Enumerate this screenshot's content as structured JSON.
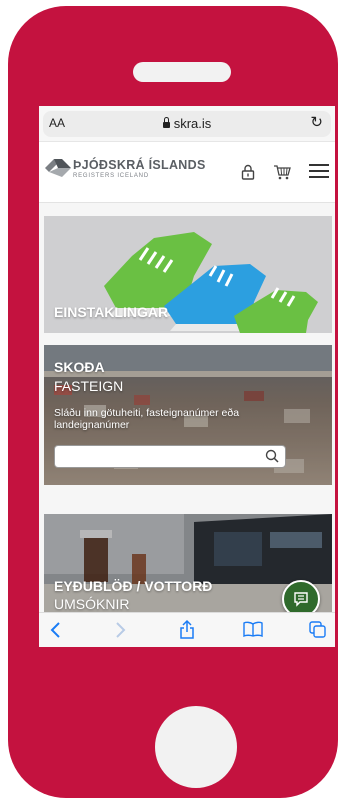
{
  "browser": {
    "text_size_label": "AA",
    "host": "skra.is"
  },
  "site": {
    "logo_main": "ÞJÓÐSKRÁ ÍSLANDS",
    "logo_sub": "REGISTERS ICELAND"
  },
  "cards": {
    "individuals": {
      "title": "EINSTAKLINGAR"
    },
    "property": {
      "title": "SKOÐA",
      "subtitle": "FASTEIGN",
      "description": "Sláðu inn götuheiti, fasteignanúmer eða landeignanúmer",
      "search_value": ""
    },
    "forms": {
      "title": "EYÐUBLÖÐ / VOTTORÐ",
      "subtitle": "UMSÓKNIR"
    }
  },
  "icons": {
    "lock": "lock-icon",
    "cart": "cart-icon",
    "menu": "hamburger-menu-icon",
    "search": "search-icon",
    "chat": "chat-icon",
    "back": "back-arrow-icon",
    "forward": "forward-arrow-icon",
    "share": "share-icon",
    "bookmarks": "book-icon",
    "tabs": "tabs-icon"
  },
  "colors": {
    "phone_frame": "#c4123f",
    "brand_green": "#2f6a2c",
    "ios_blue": "#1a7cf5"
  }
}
